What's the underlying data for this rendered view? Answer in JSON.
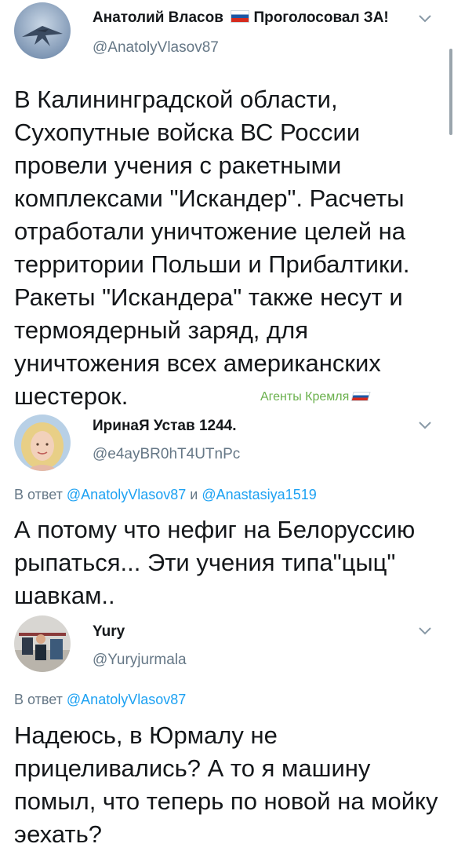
{
  "tweets": [
    {
      "author_name": "Анатолий Власов",
      "author_badge": "Проголосовал ЗА!",
      "handle": "@AnatolyVlasov87",
      "text": "В Калининградской области, Сухопутные войска ВС России провели учения с ракетными комплексами \"Искандер\". Расчеты отработали уничтожение целей на территории Польши и Прибалтики. Ракеты \"Искандера\" также несут и термоядерный заряд, для уничтожения всех американских шестерок."
    },
    {
      "author_name": "ИринаЯ Устав 1244.",
      "handle": "@e4ayBR0hT4UTnPc",
      "reply_prefix": "В ответ",
      "reply_to_1": "@AnatolyVlasov87",
      "reply_and": "и",
      "reply_to_2": "@Anastasiya1519",
      "text": "А потому что нефиг на Белоруссию рыпаться... Эти учения типа\"цыц\" шавкам.."
    },
    {
      "author_name": "Yury",
      "handle": "@Yuryjurmala",
      "reply_prefix": "В ответ",
      "reply_to_1": "@AnatolyVlasov87",
      "text": "Надеюсь, в Юрмалу не прицеливались? А то я машину помыл, что теперь по новой на мойку эехать?"
    }
  ],
  "watermark": "Агенты Кремля",
  "icons": {
    "flag": "russia-flag-icon",
    "chevron": "chevron-down-icon"
  },
  "colors": {
    "link": "#1da1f2",
    "secondary_text": "#657786",
    "watermark": "#6ab04c"
  }
}
